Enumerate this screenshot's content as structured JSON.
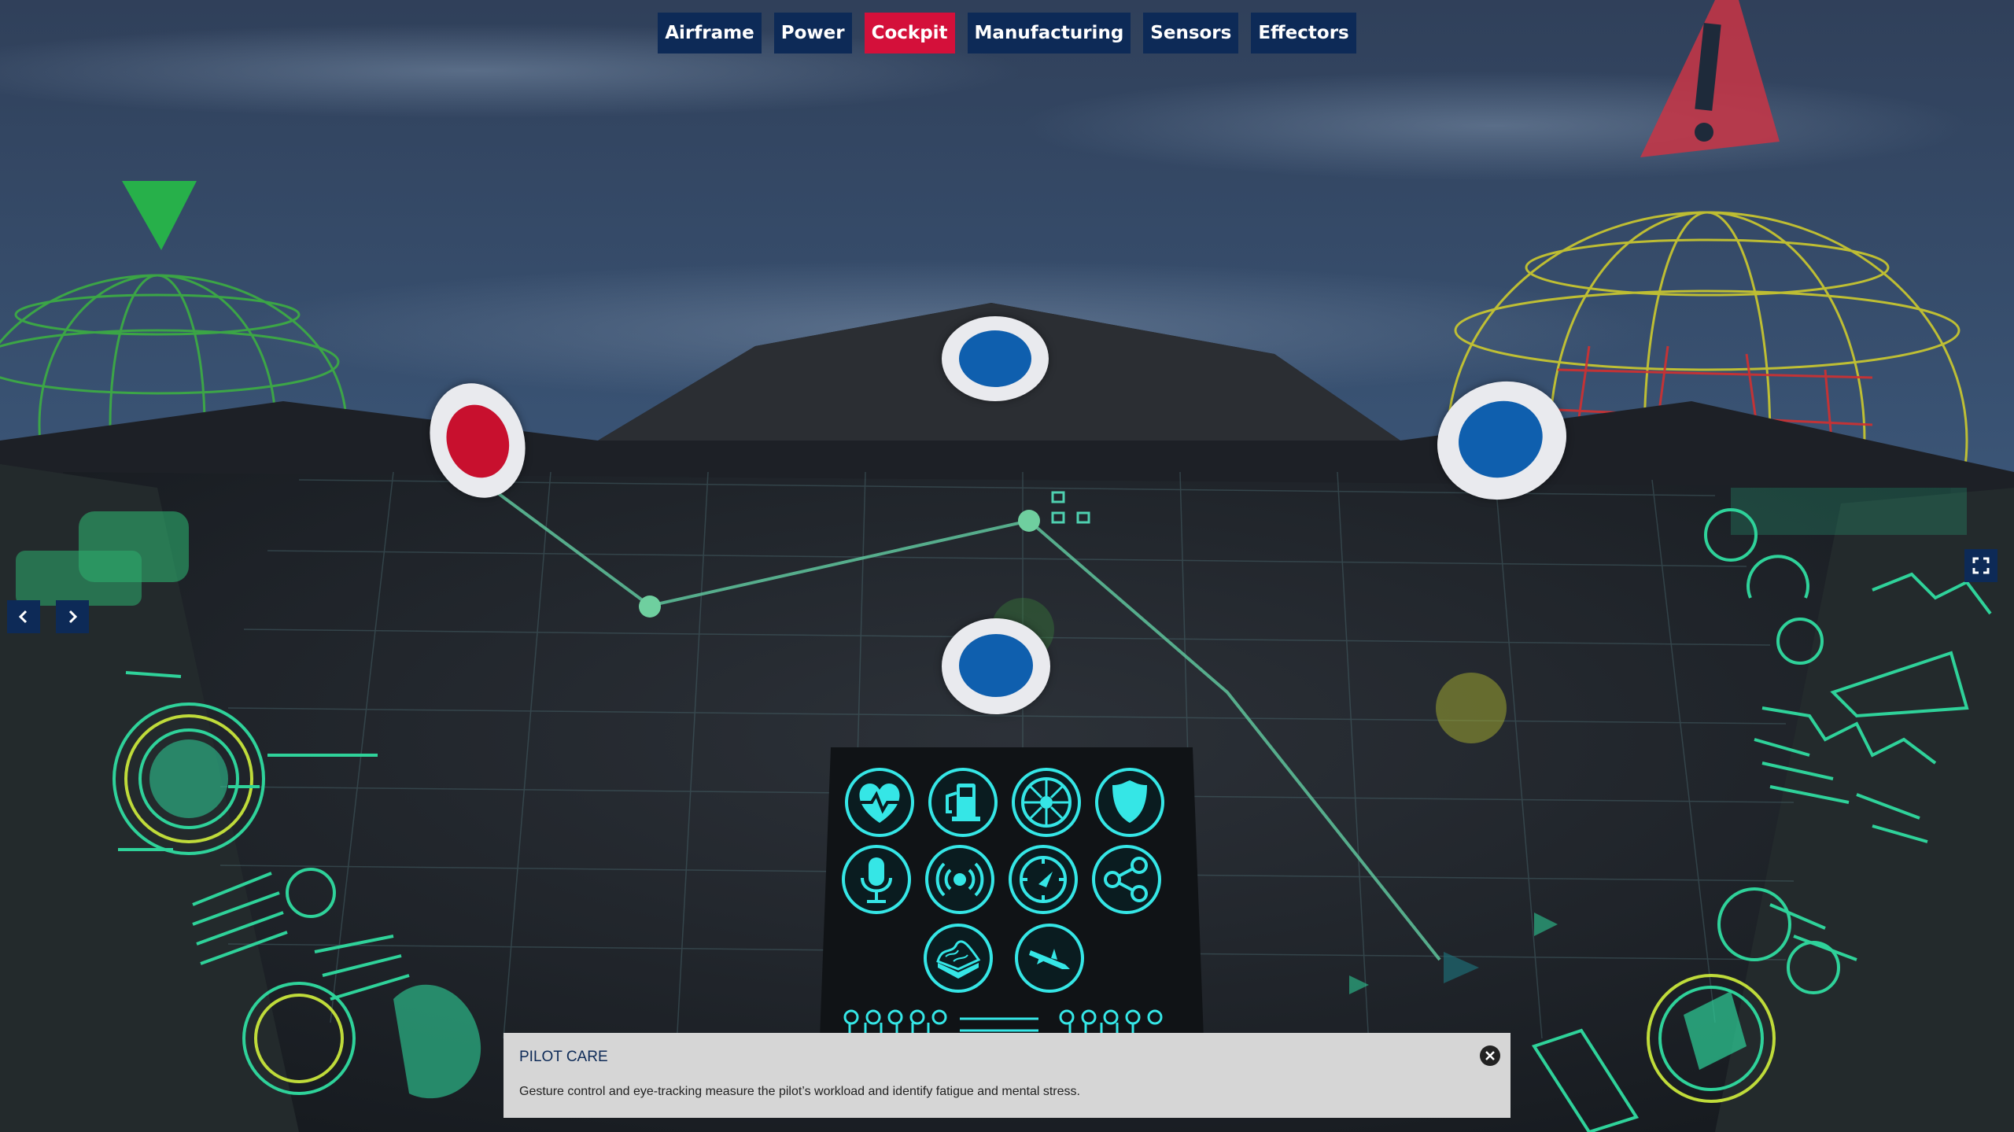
{
  "nav": {
    "tabs": [
      {
        "label": "Airframe",
        "active": false
      },
      {
        "label": "Power",
        "active": false
      },
      {
        "label": "Cockpit",
        "active": true
      },
      {
        "label": "Manufacturing",
        "active": false
      },
      {
        "label": "Sensors",
        "active": false
      },
      {
        "label": "Effectors",
        "active": false
      }
    ]
  },
  "carousel": {
    "prev_icon": "chevron-left-icon",
    "next_icon": "chevron-right-icon",
    "fullscreen_icon": "fullscreen-icon"
  },
  "hotspots": [
    {
      "name": "hotspot-red-left",
      "color": "#c8102e"
    },
    {
      "name": "hotspot-blue-top",
      "color": "#0f5fae"
    },
    {
      "name": "hotspot-blue-right",
      "color": "#0f5fae"
    },
    {
      "name": "hotspot-blue-center",
      "color": "#0f5fae"
    }
  ],
  "cockpit_icons": [
    "heart-rate-icon",
    "fuel-icon",
    "engine-turbine-icon",
    "shield-icon",
    "microphone-icon",
    "radio-signal-icon",
    "gauge-icon",
    "network-share-icon",
    "terrain-map-icon",
    "missile-icon"
  ],
  "warning_icon": "warning-triangle-icon",
  "info_panel": {
    "title": "PILOT CARE",
    "text": "Gesture control and eye-tracking measure the pilot’s workload and identify fatigue and mental stress.",
    "close_icon": "close-icon"
  },
  "colors": {
    "nav_bg": "#0d2a57",
    "nav_active": "#d4103a",
    "hud_cyan": "#35e6e6",
    "hud_green": "#3ccf8e",
    "warning_red": "#d43a4a"
  }
}
